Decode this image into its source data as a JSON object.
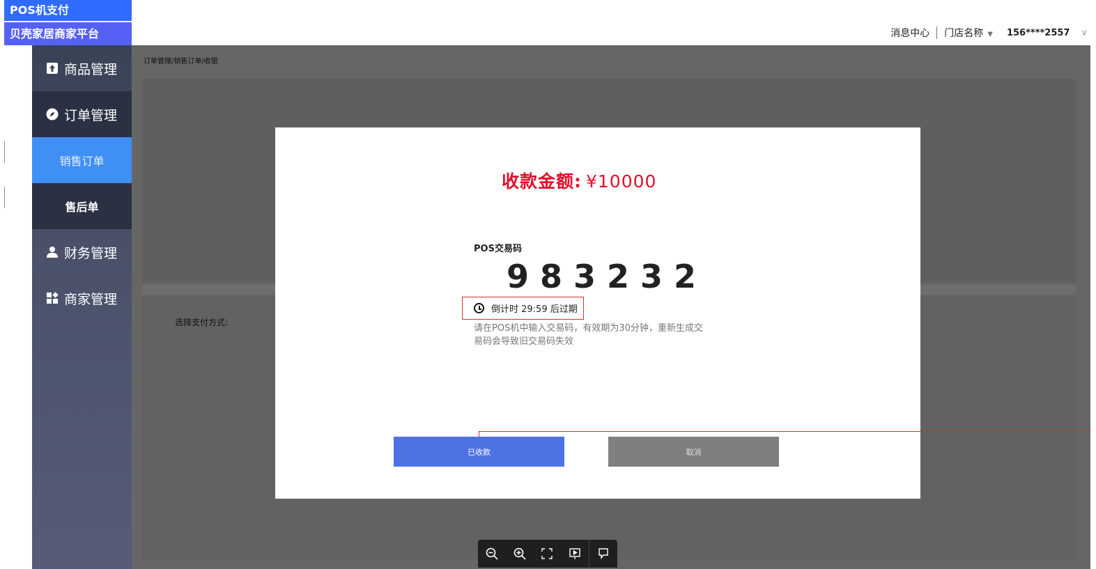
{
  "header": {
    "pos_tag": "POS机支付",
    "platform_name": "贝壳家居商家平台",
    "messages": "消息中心",
    "store_name": "门店名称",
    "user_phone": "156****2557"
  },
  "sidebar": {
    "items": [
      {
        "label": "商品管理",
        "icon": "upload-square-icon"
      },
      {
        "label": "订单管理",
        "icon": "compass-icon"
      },
      {
        "label": "销售订单"
      },
      {
        "label": "售后单"
      },
      {
        "label": "财务管理",
        "icon": "user-icon"
      },
      {
        "label": "商家管理",
        "icon": "apps-icon"
      }
    ]
  },
  "main": {
    "breadcrumb": "订单管理/销售订单/收银",
    "pay_method_label": "选择支付方式:"
  },
  "modal": {
    "amount_label": "收款金额:",
    "amount_value": "¥10000",
    "pos_code_label": "POS交易码",
    "pos_code": "983232",
    "countdown": "倒计时 29:59 后过期",
    "hint": "请在POS机中输入交易码，有效期为30分钟，重新生成交易码会导致旧交易码失效",
    "confirm_button": "已收款",
    "cancel_button": "取消"
  },
  "colors": {
    "primary_blue": "#2f6bff",
    "accent_red": "#e0102a",
    "confirm_blue": "#4f72e3",
    "sidebar_active": "#3f8ff5"
  }
}
